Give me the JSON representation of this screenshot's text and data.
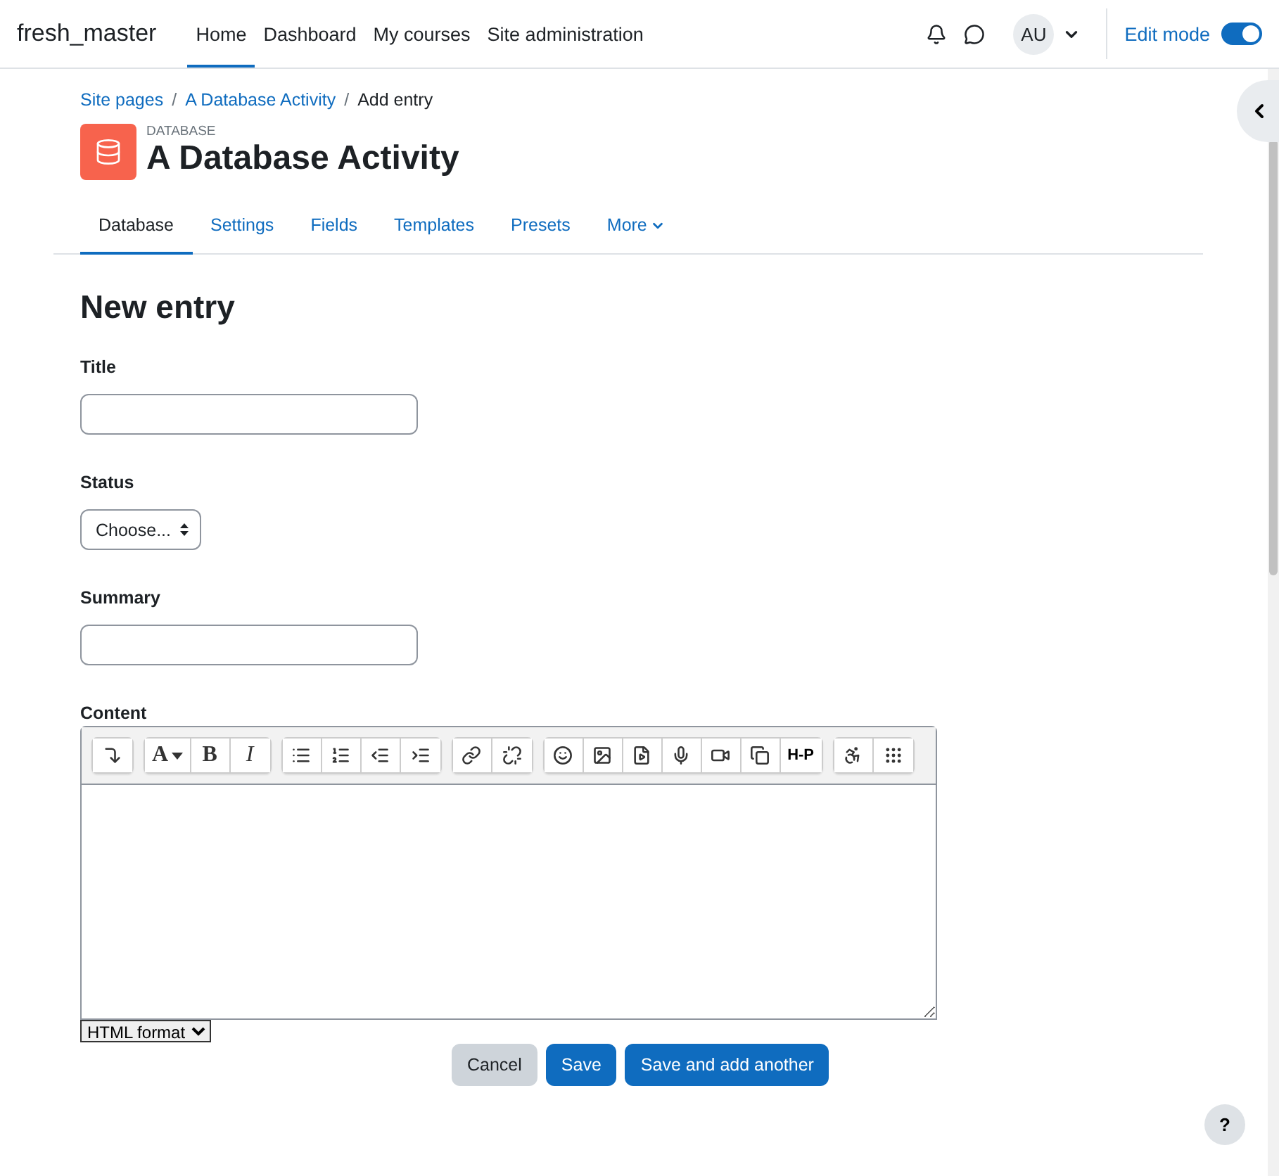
{
  "navbar": {
    "brand": "fresh_master",
    "links": [
      {
        "label": "Home",
        "selected": true
      },
      {
        "label": "Dashboard",
        "selected": false
      },
      {
        "label": "My courses",
        "selected": false
      },
      {
        "label": "Site administration",
        "selected": false
      }
    ],
    "avatar": "AU",
    "edit_mode": {
      "label": "Edit mode",
      "on": true
    }
  },
  "breadcrumb": [
    {
      "label": "Site pages",
      "link": true
    },
    {
      "separator": "/",
      "label": "A Database Activity",
      "link": true
    },
    {
      "separator": "/",
      "label": "Add entry",
      "link": false
    }
  ],
  "activity": {
    "type": "DATABASE",
    "title": "A Database Activity"
  },
  "tabs": [
    {
      "label": "Database",
      "selected": true
    },
    {
      "label": "Settings",
      "selected": false
    },
    {
      "label": "Fields",
      "selected": false
    },
    {
      "label": "Templates",
      "selected": false
    },
    {
      "label": "Presets",
      "selected": false
    },
    {
      "label": "More",
      "selected": false,
      "dropdown": true
    }
  ],
  "form": {
    "heading": "New entry",
    "fields": [
      {
        "kind": "text",
        "label": "Title"
      },
      {
        "kind": "select",
        "label": "Status",
        "value": "Choose..."
      },
      {
        "kind": "text",
        "label": "Summary"
      },
      {
        "kind": "editor",
        "label": "Content",
        "format": "HTML format"
      }
    ]
  },
  "toolbar": [
    [
      {
        "kind": "expand"
      }
    ],
    [
      {
        "kind": "text",
        "label": "A",
        "caret": true
      },
      {
        "kind": "text",
        "label": "B"
      },
      {
        "kind": "text",
        "label": "I",
        "italic": true
      }
    ],
    [
      {
        "kind": "bullets"
      },
      {
        "kind": "numbers"
      },
      {
        "kind": "outdent"
      },
      {
        "kind": "indent"
      }
    ],
    [
      {
        "kind": "link"
      },
      {
        "kind": "unlink"
      }
    ],
    [
      {
        "kind": "emoji"
      },
      {
        "kind": "image"
      },
      {
        "kind": "media"
      },
      {
        "kind": "mic"
      },
      {
        "kind": "video"
      },
      {
        "kind": "copy"
      },
      {
        "kind": "text",
        "label": "H-P",
        "bold": true
      }
    ],
    [
      {
        "kind": "accessibility"
      },
      {
        "kind": "braille"
      }
    ]
  ],
  "buttons": [
    {
      "label": "Cancel",
      "kind": "secondary"
    },
    {
      "label": "Save",
      "kind": "primary"
    },
    {
      "label": "Save and add another",
      "kind": "primary"
    }
  ],
  "help": "?"
}
